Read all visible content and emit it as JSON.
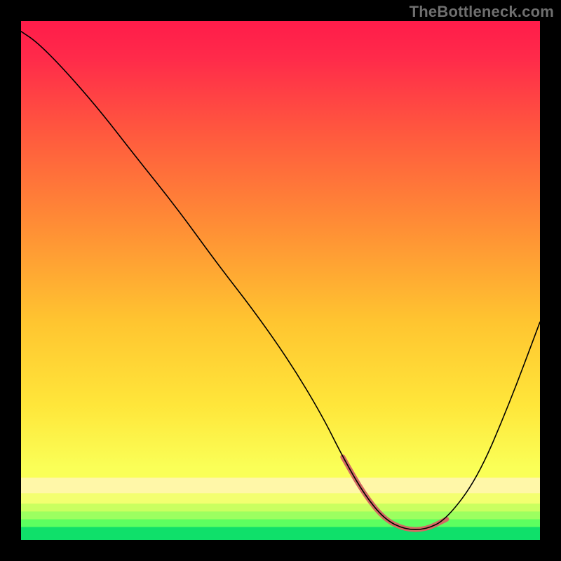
{
  "watermark": "TheBottleneck.com",
  "chart_data": {
    "type": "line",
    "title": "",
    "xlabel": "",
    "ylabel": "",
    "xlim": [
      0,
      100
    ],
    "ylim": [
      0,
      100
    ],
    "background_gradient": {
      "top_color": "#ff1c4a",
      "mid_color": "#ffe23a",
      "bottom_color": "#0fe06a"
    },
    "bottom_bands": [
      {
        "color": "#fff7a8",
        "y0": 88.0,
        "y1": 91.0
      },
      {
        "color": "#f3ff70",
        "y0": 91.0,
        "y1": 93.0
      },
      {
        "color": "#caff60",
        "y0": 93.0,
        "y1": 94.5
      },
      {
        "color": "#9cff60",
        "y0": 94.5,
        "y1": 96.0
      },
      {
        "color": "#5dff60",
        "y0": 96.0,
        "y1": 97.5
      },
      {
        "color": "#0fe06a",
        "y0": 97.5,
        "y1": 100.0
      }
    ],
    "series": [
      {
        "name": "curve",
        "stroke": "#000000",
        "stroke_width": 1.6,
        "x": [
          0,
          3,
          8,
          15,
          22,
          30,
          38,
          45,
          52,
          58,
          62,
          66,
          70,
          74,
          78,
          82,
          88,
          94,
          100
        ],
        "y": [
          98,
          96,
          91,
          83,
          74,
          64,
          53,
          44,
          34,
          24,
          16,
          9,
          4,
          2,
          2,
          4,
          12,
          26,
          42
        ]
      }
    ],
    "highlight_segment": {
      "name": "flat-optimal",
      "stroke": "#d36a63",
      "stroke_width": 7,
      "x": [
        62,
        66,
        70,
        74,
        78,
        82
      ],
      "y": [
        16,
        9,
        4,
        2,
        2,
        4
      ]
    }
  }
}
